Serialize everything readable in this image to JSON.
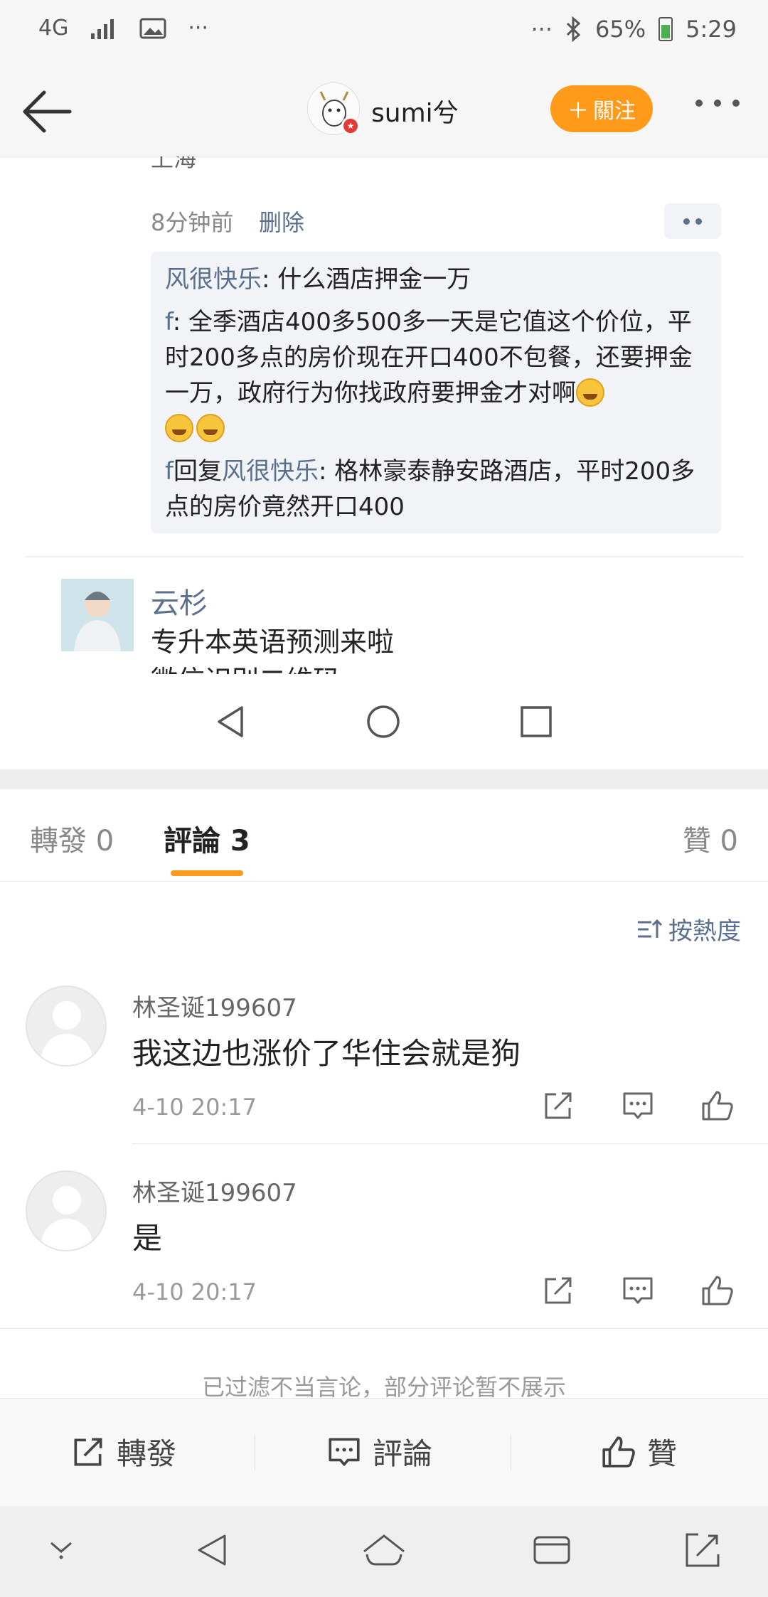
{
  "status_bar": {
    "network": "4G",
    "battery_percent": "65%",
    "time": "5:29",
    "overflow": "···"
  },
  "nav": {
    "username": "sumi兮",
    "follow_label": "关注",
    "follow_label_display": "關注",
    "avatar_icon": "cartoon-avatar"
  },
  "embedded": {
    "clipped_location": "上海",
    "post_time": "8分钟前",
    "delete_label": "删除",
    "replies": [
      {
        "user": "风很快乐",
        "sep": ": ",
        "text": "什么酒店押金一万"
      },
      {
        "user": "f",
        "sep": ": ",
        "text": "全季酒店400多500多一天是它值这个价位，平时200多点的房价现在开口400不包餐，还要押金一万，政府行为你找政府要押金才对啊"
      },
      {
        "user": "f",
        "mid": "回复",
        "user2": "风很快乐",
        "sep": ": ",
        "text": "格林豪泰静安路酒店，平时200多点的房价竟然开口400"
      }
    ],
    "next_user": {
      "name": "云杉",
      "line1": "专升本英语预测来啦",
      "line2": "微信识别二维码"
    }
  },
  "tabs": {
    "repost": "轉發 0",
    "comments": "評論 3",
    "likes": "贊 0"
  },
  "sort_label": "按熱度",
  "comments": [
    {
      "name": "林圣诞199607",
      "text": "我这边也涨价了华住会就是狗",
      "time": "4-10 20:17"
    },
    {
      "name": "林圣诞199607",
      "text": "是",
      "time": "4-10 20:17"
    }
  ],
  "filtered_notice": "已过滤不当言论，部分评论暂不展示",
  "bottom_bar": {
    "repost": "轉發",
    "comment": "評論",
    "like": "贊"
  },
  "colors": {
    "accent": "#ff9a1a",
    "link": "#5b6f8e"
  }
}
